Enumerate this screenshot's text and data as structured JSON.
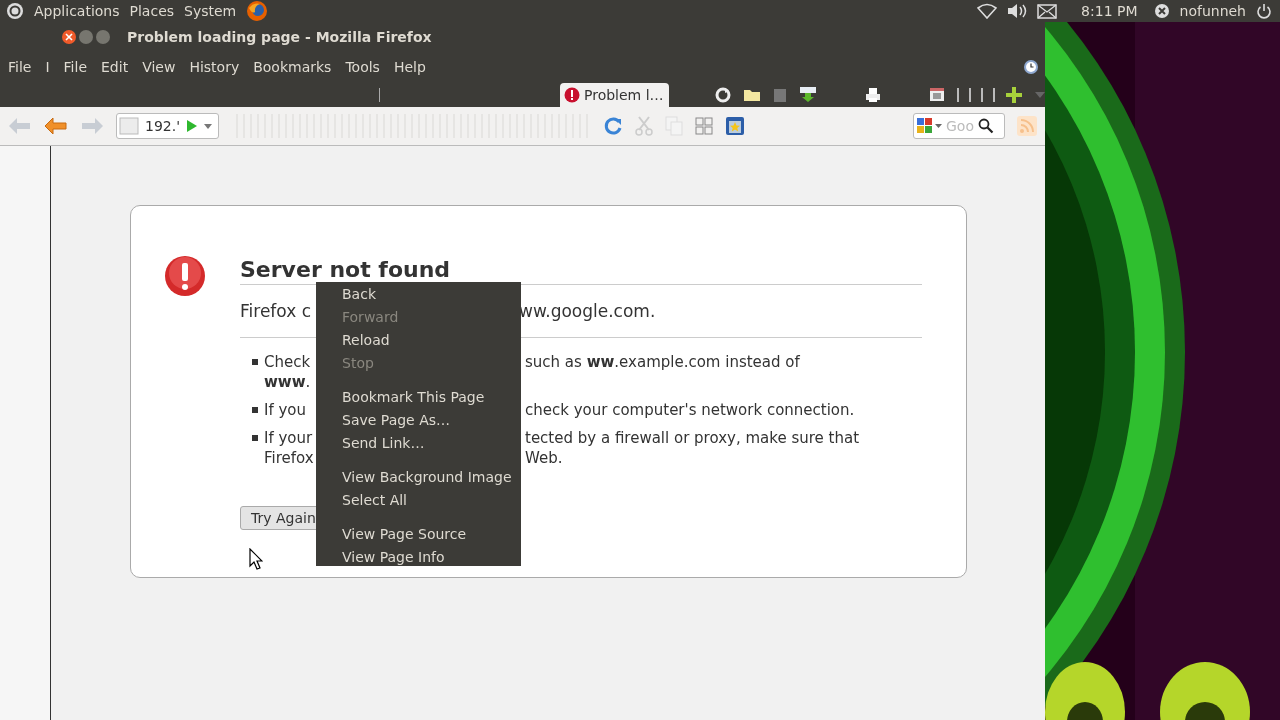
{
  "top_panel": {
    "menus": [
      "Applications",
      "Places",
      "System"
    ],
    "clock": "8:11 PM",
    "user": "nofunneh"
  },
  "window": {
    "title": "Problem loading page - Mozilla Firefox"
  },
  "menu_bar": [
    "File",
    "I",
    "File",
    "Edit",
    "View",
    "History",
    "Bookmarks",
    "Tools",
    "Help"
  ],
  "tab": {
    "label": "Problem l…",
    "selected": true
  },
  "address": {
    "value": "192.'"
  },
  "search": {
    "placeholder": "Goo"
  },
  "error_page": {
    "title": "Server not found",
    "intro": {
      "left": "Firefox c",
      "right": "ww.google.com."
    },
    "bullets": [
      {
        "lines": [
          {
            "left": "Check",
            "right": "such as **ww**.example.com instead of"
          },
          {
            "left": "**www**."
          }
        ]
      },
      {
        "lines": [
          {
            "left": "If you",
            "right": "check your computer's network connection."
          }
        ]
      },
      {
        "lines": [
          {
            "left": "If your",
            "right": "tected by a firewall or proxy, make sure that"
          },
          {
            "left": "Firefox",
            "right": "Web."
          }
        ]
      }
    ],
    "button": "Try Again"
  },
  "context_menu": [
    {
      "label": "Back",
      "disabled": false,
      "group_start": false
    },
    {
      "label": "Forward",
      "disabled": true,
      "group_start": false
    },
    {
      "label": "Reload",
      "disabled": false,
      "group_start": false
    },
    {
      "label": "Stop",
      "disabled": true,
      "group_start": false
    },
    {
      "label": "Bookmark This Page",
      "disabled": false,
      "group_start": true
    },
    {
      "label": "Save Page As…",
      "disabled": false,
      "group_start": false
    },
    {
      "label": "Send Link…",
      "disabled": false,
      "group_start": false
    },
    {
      "label": "View Background Image",
      "disabled": false,
      "group_start": true
    },
    {
      "label": "Select All",
      "disabled": false,
      "group_start": false
    },
    {
      "label": "View Page Source",
      "disabled": false,
      "group_start": true
    },
    {
      "label": "View Page Info",
      "disabled": false,
      "group_start": false
    }
  ]
}
